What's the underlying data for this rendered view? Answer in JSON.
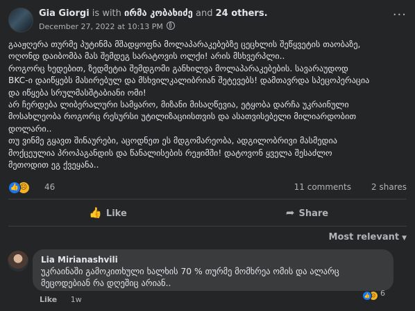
{
  "post": {
    "author": "Gia Giorgi",
    "with_word": "is with",
    "tagged": "ირმა კობახიძე",
    "and_word": "and",
    "others": "24 others.",
    "date": "December 27, 2022 at 10:13 PM",
    "more_glyph": "···",
    "paragraphs": [
      "გააჟღერა თურმე პუტინმა მშადყოფნა მოლაპარაკებებზე ცეცხლის შეწყვეტის თაობაზე,\nოღონდ დაიბომბა მას შემდეგ სარატოვის ოლქი! არის მსხვერპლი..",
      "როგორც ხედებით, ზედმეტია შემდგომი განხილვა მოლაპარაკებების. სავარაუდოდ\nBKC-ი დაიწყებს მასირებულ და მსხვილკალიბრიან შეტევებს! დამთავრდა სპეცოპერაცია\nდა იწყება სრულმასშტაბიანი ომი!",
      "არ ჩერდება ლიბერალური სამყარო, მიზანი მისაღწევია, ეტყობა დარჩა უკრაინული\nმოსახლეობა როგორც რესურსი უტილიზაციისთვის და ასათვისებელი მილიარდობით\nდოლარი..",
      "თუ ვინმე გყავთ შინაურები, აცოდნეთ ეს მდგომარეობა, ადგილობრივი მასმედია\nმოქცეულია პროპაგანდის და წანალისების რეჟიმში! დატოვონ ყველა შესაძლო\nმეთოდით ეგ ქვეყანა.."
    ]
  },
  "stats": {
    "reactions_count": "46",
    "comments": "11 comments",
    "shares": "2 shares",
    "reaction_icons": [
      "like-icon",
      "sad-face-icon"
    ]
  },
  "actions": {
    "like": "Like",
    "share": "Share"
  },
  "sort": {
    "label": "Most relevant"
  },
  "comment": {
    "author": "Lia Mirianashvili",
    "text": "უკრაინაში გამოკითხული ხალხის 70 % თურმე მომხრეა ომის და ალარც\nმეცოდებიან რა დღეშიც არიან..",
    "reactions_count": "6",
    "like": "Like",
    "time": "1w"
  },
  "colors": {
    "background": "#242526",
    "bubble": "#3a3b3c",
    "primary_text": "#e4e6eb",
    "secondary_text": "#b0b3b8",
    "like_blue": "#1877f2",
    "sad_yellow": "#f7b125"
  }
}
